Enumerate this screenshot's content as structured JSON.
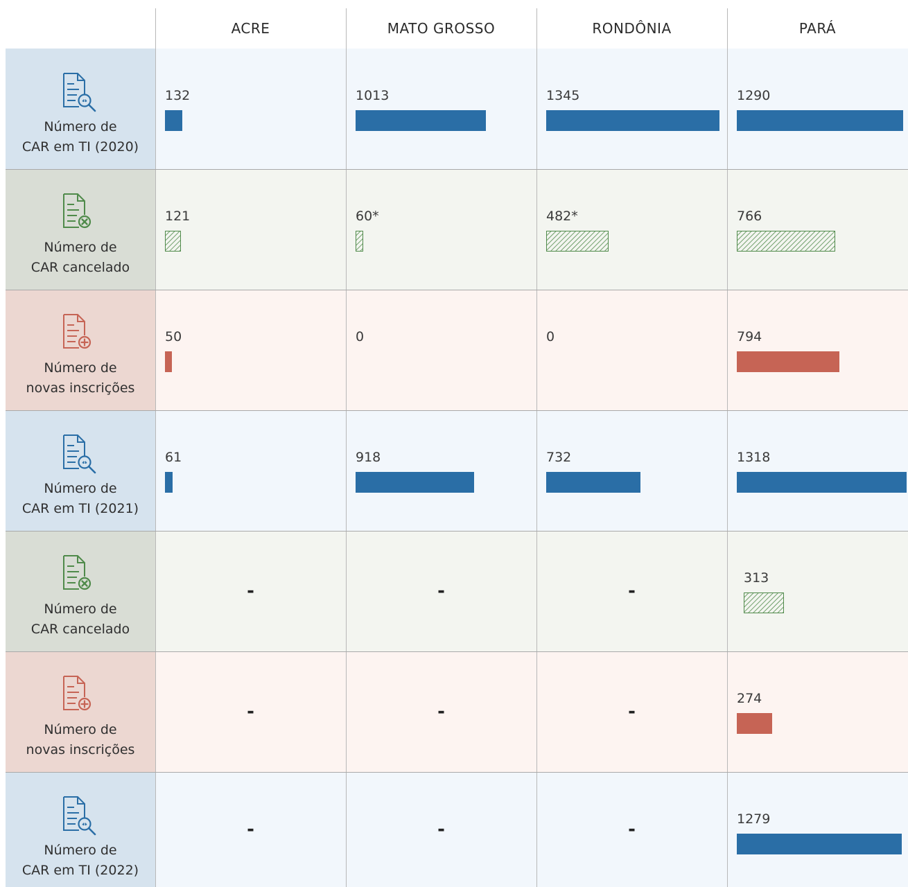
{
  "chart_data": {
    "type": "table",
    "columns": [
      "ACRE",
      "MATO GROSSO",
      "RONDÔNIA",
      "PARÁ"
    ],
    "rows": [
      {
        "label_line1": "Número de",
        "label_line2": "CAR em TI (2020)",
        "kind": "car",
        "icon": "document-search-icon",
        "values": [
          "132",
          "1013",
          "1345",
          "1290"
        ]
      },
      {
        "label_line1": "Número de",
        "label_line2": "CAR cancelado",
        "kind": "cancel",
        "icon": "document-cancel-icon",
        "values": [
          "121",
          "60*",
          "482*",
          "766"
        ]
      },
      {
        "label_line1": "Número de",
        "label_line2": "novas inscrições",
        "kind": "new",
        "icon": "document-add-icon",
        "values": [
          "50",
          "0",
          "0",
          "794"
        ]
      },
      {
        "label_line1": "Número de",
        "label_line2": "CAR em TI (2021)",
        "kind": "car",
        "icon": "document-search-icon",
        "values": [
          "61",
          "918",
          "732",
          "1318"
        ]
      },
      {
        "label_line1": "Número de",
        "label_line2": "CAR cancelado",
        "kind": "cancel",
        "icon": "document-cancel-icon",
        "values": [
          "-",
          "-",
          "-",
          "313"
        ]
      },
      {
        "label_line1": "Número de",
        "label_line2": "novas inscrições",
        "kind": "new",
        "icon": "document-add-icon",
        "values": [
          "-",
          "-",
          "-",
          "274"
        ]
      },
      {
        "label_line1": "Número de",
        "label_line2": "CAR em TI (2022)",
        "kind": "car",
        "icon": "document-search-icon",
        "values": [
          "-",
          "-",
          "-",
          "1279"
        ]
      }
    ],
    "colors": {
      "car": "#2a6ea6",
      "cancel": "#4f8a4a",
      "new": "#c66455",
      "car_head_bg": "#d6e3ee",
      "car_row_bg": "#f2f7fc",
      "cancel_head_bg": "#d9ddd5",
      "cancel_row_bg": "#f3f5f0",
      "new_head_bg": "#ecd7d1",
      "new_row_bg": "#fdf4f1"
    }
  }
}
